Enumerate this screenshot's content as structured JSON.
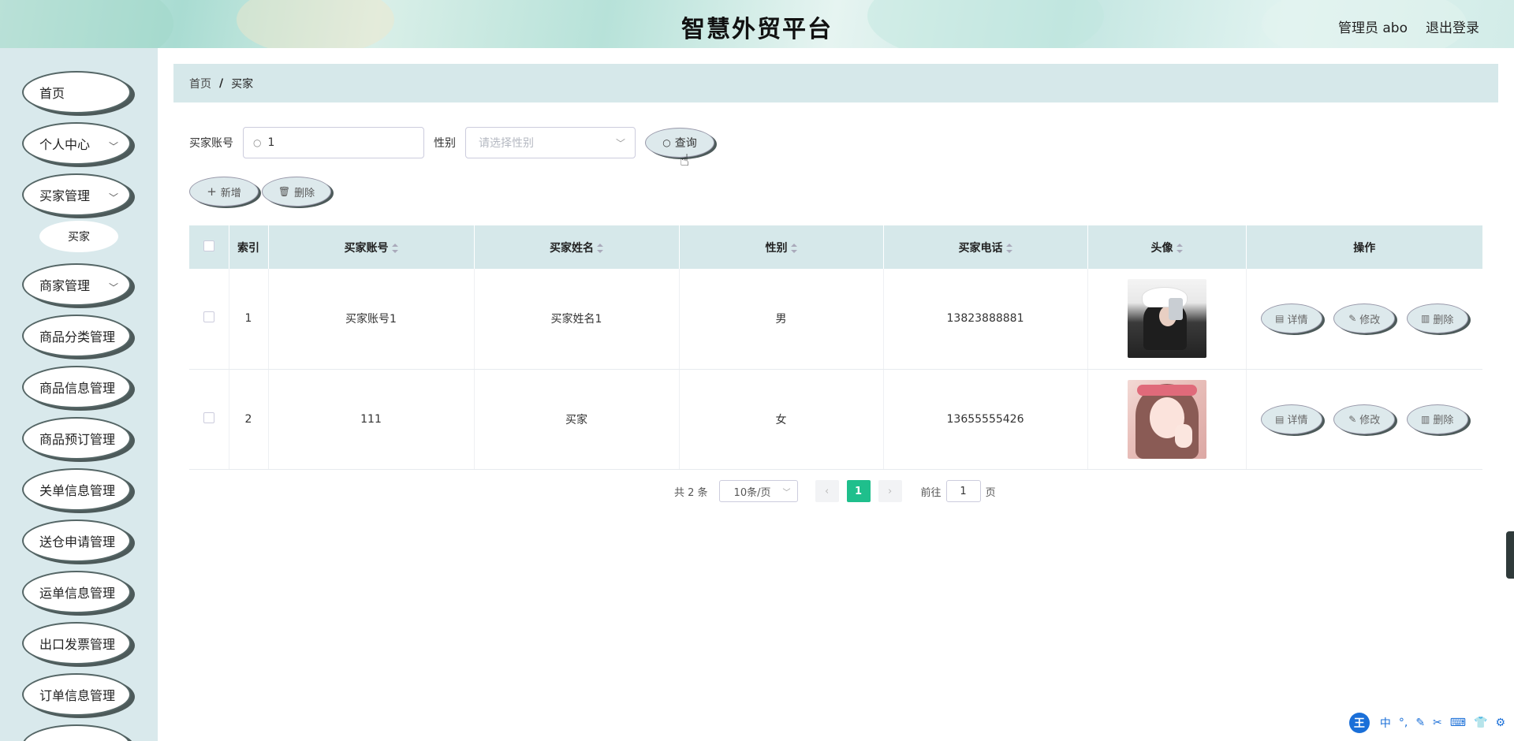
{
  "header": {
    "title": "智慧外贸平台",
    "admin_label": "管理员 abo",
    "logout_label": "退出登录"
  },
  "sidebar": {
    "items": [
      {
        "label": "首页",
        "has_chevron": false
      },
      {
        "label": "个人中心",
        "has_chevron": true
      },
      {
        "label": "买家管理",
        "has_chevron": true
      },
      {
        "label": "买家",
        "submenu": true
      },
      {
        "label": "商家管理",
        "has_chevron": true
      },
      {
        "label": "商品分类管理",
        "has_chevron": false
      },
      {
        "label": "商品信息管理",
        "has_chevron": false
      },
      {
        "label": "商品预订管理",
        "has_chevron": false
      },
      {
        "label": "关单信息管理",
        "has_chevron": false
      },
      {
        "label": "送仓申请管理",
        "has_chevron": false
      },
      {
        "label": "运单信息管理",
        "has_chevron": false
      },
      {
        "label": "出口发票管理",
        "has_chevron": false
      },
      {
        "label": "订单信息管理",
        "has_chevron": false
      }
    ]
  },
  "breadcrumb": {
    "home": "首页",
    "separator": "/",
    "current": "买家"
  },
  "search": {
    "account_label": "买家账号",
    "account_value": "1",
    "gender_label": "性别",
    "gender_placeholder": "请选择性别",
    "query_label": "查询"
  },
  "actions": {
    "add_label": "新增",
    "delete_label": "删除"
  },
  "table": {
    "headers": {
      "index": "索引",
      "account": "买家账号",
      "name": "买家姓名",
      "gender": "性别",
      "phone": "买家电话",
      "avatar": "头像",
      "ops": "操作"
    },
    "rows": [
      {
        "index": "1",
        "account": "买家账号1",
        "name": "买家姓名1",
        "gender": "男",
        "phone": "13823888881"
      },
      {
        "index": "2",
        "account": "111",
        "name": "买家",
        "gender": "女",
        "phone": "13655555426"
      }
    ],
    "op_labels": {
      "detail": "详情",
      "edit": "修改",
      "delete": "删除"
    }
  },
  "pagination": {
    "total": "共 2 条",
    "page_size": "10条/页",
    "current_page": "1",
    "goto_prefix": "前往",
    "goto_value": "1",
    "goto_suffix": "页"
  },
  "ime": {
    "logo": "王",
    "items": [
      "中",
      "°,",
      "✎",
      "✂",
      "⌨",
      "👕",
      "⚙"
    ]
  },
  "colors": {
    "accent": "#1fbf8c",
    "sidebar_bg": "#d9e9ec",
    "header_bg": "#d6e8ea"
  }
}
